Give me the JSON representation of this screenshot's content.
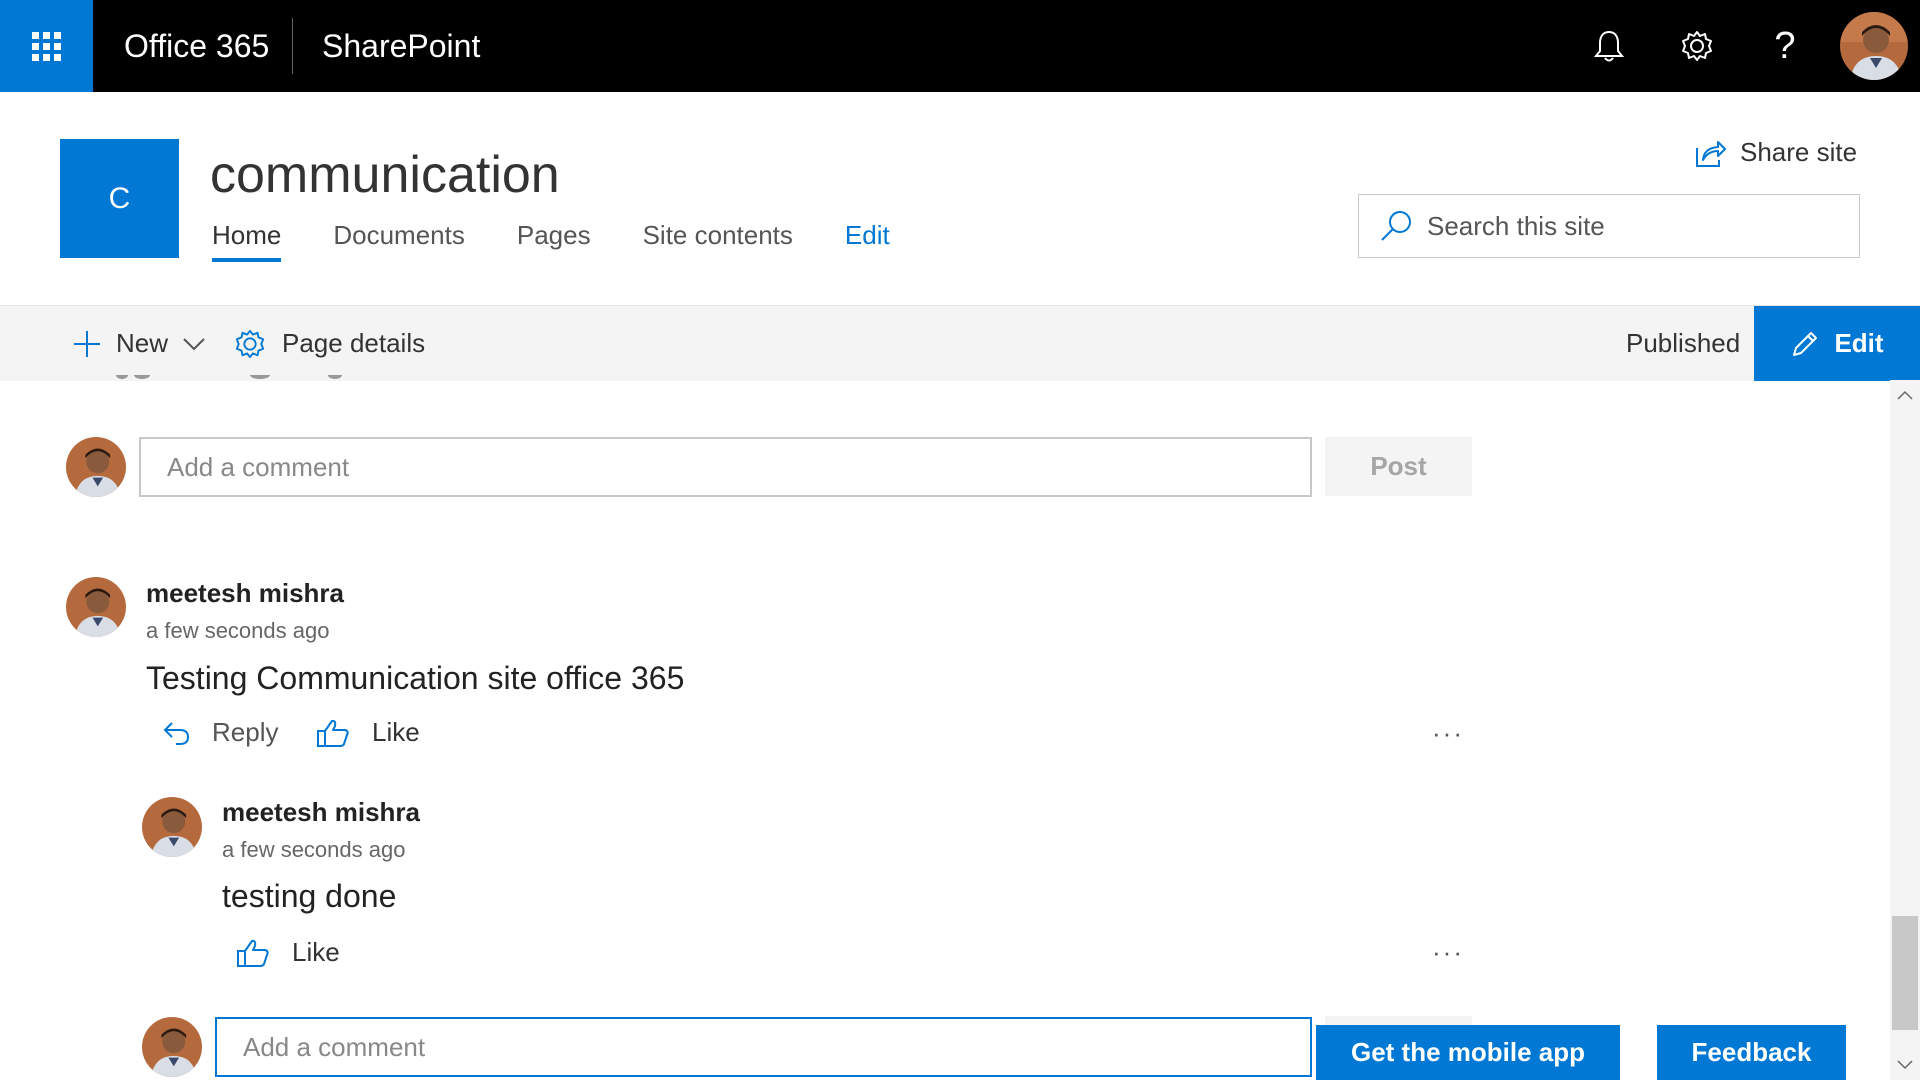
{
  "suitebar": {
    "app_launcher_icon": "waffle-icon",
    "brand": "Office 365",
    "product": "SharePoint",
    "icons": [
      "bell-icon",
      "gear-icon",
      "help-icon"
    ],
    "help_glyph": "?"
  },
  "site": {
    "logo_letter": "C",
    "title": "communication",
    "nav": [
      "Home",
      "Documents",
      "Pages",
      "Site contents",
      "Edit"
    ],
    "share_label": "Share site",
    "search_placeholder": "Search this site"
  },
  "commandbar": {
    "new_label": "New",
    "page_details_label": "Page details",
    "status": "Published",
    "edit_label": "Edit"
  },
  "comments": {
    "input_placeholder": "Add a comment",
    "post_label": "Post",
    "thread": [
      {
        "author": "meetesh mishra",
        "time": "a few seconds ago",
        "text": "Testing Communication site office 365",
        "reply_label": "Reply",
        "like_label": "Like",
        "more": "···"
      },
      {
        "author": "meetesh mishra",
        "time": "a few seconds ago",
        "text": "testing done",
        "like_label": "Like",
        "more": "···"
      }
    ],
    "reply_input_placeholder": "Add a comment"
  },
  "footer": {
    "mobile_app_label": "Get the mobile app",
    "feedback_label": "Feedback"
  },
  "colors": {
    "accent": "#0078d4",
    "suitebar": "#000000",
    "commandbar": "#f4f4f4"
  }
}
